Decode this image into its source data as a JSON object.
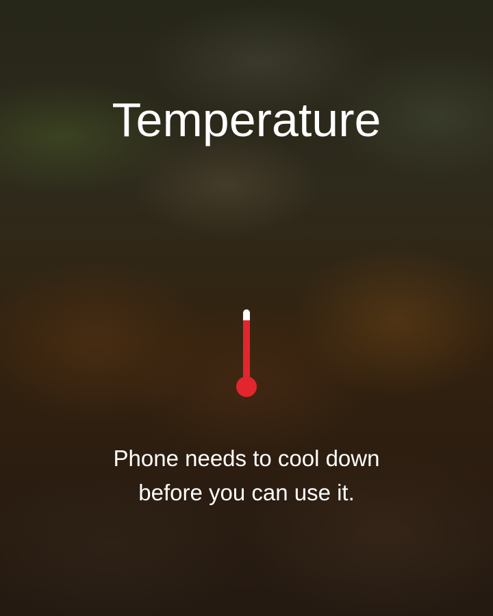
{
  "screen": {
    "title": "Temperature",
    "message_line1": "Phone needs to cool down",
    "message_line2": "before you can use it.",
    "thermometer": {
      "icon": "thermometer-icon",
      "fill_color": "#e3262d",
      "empty_color": "#ffffff"
    }
  }
}
